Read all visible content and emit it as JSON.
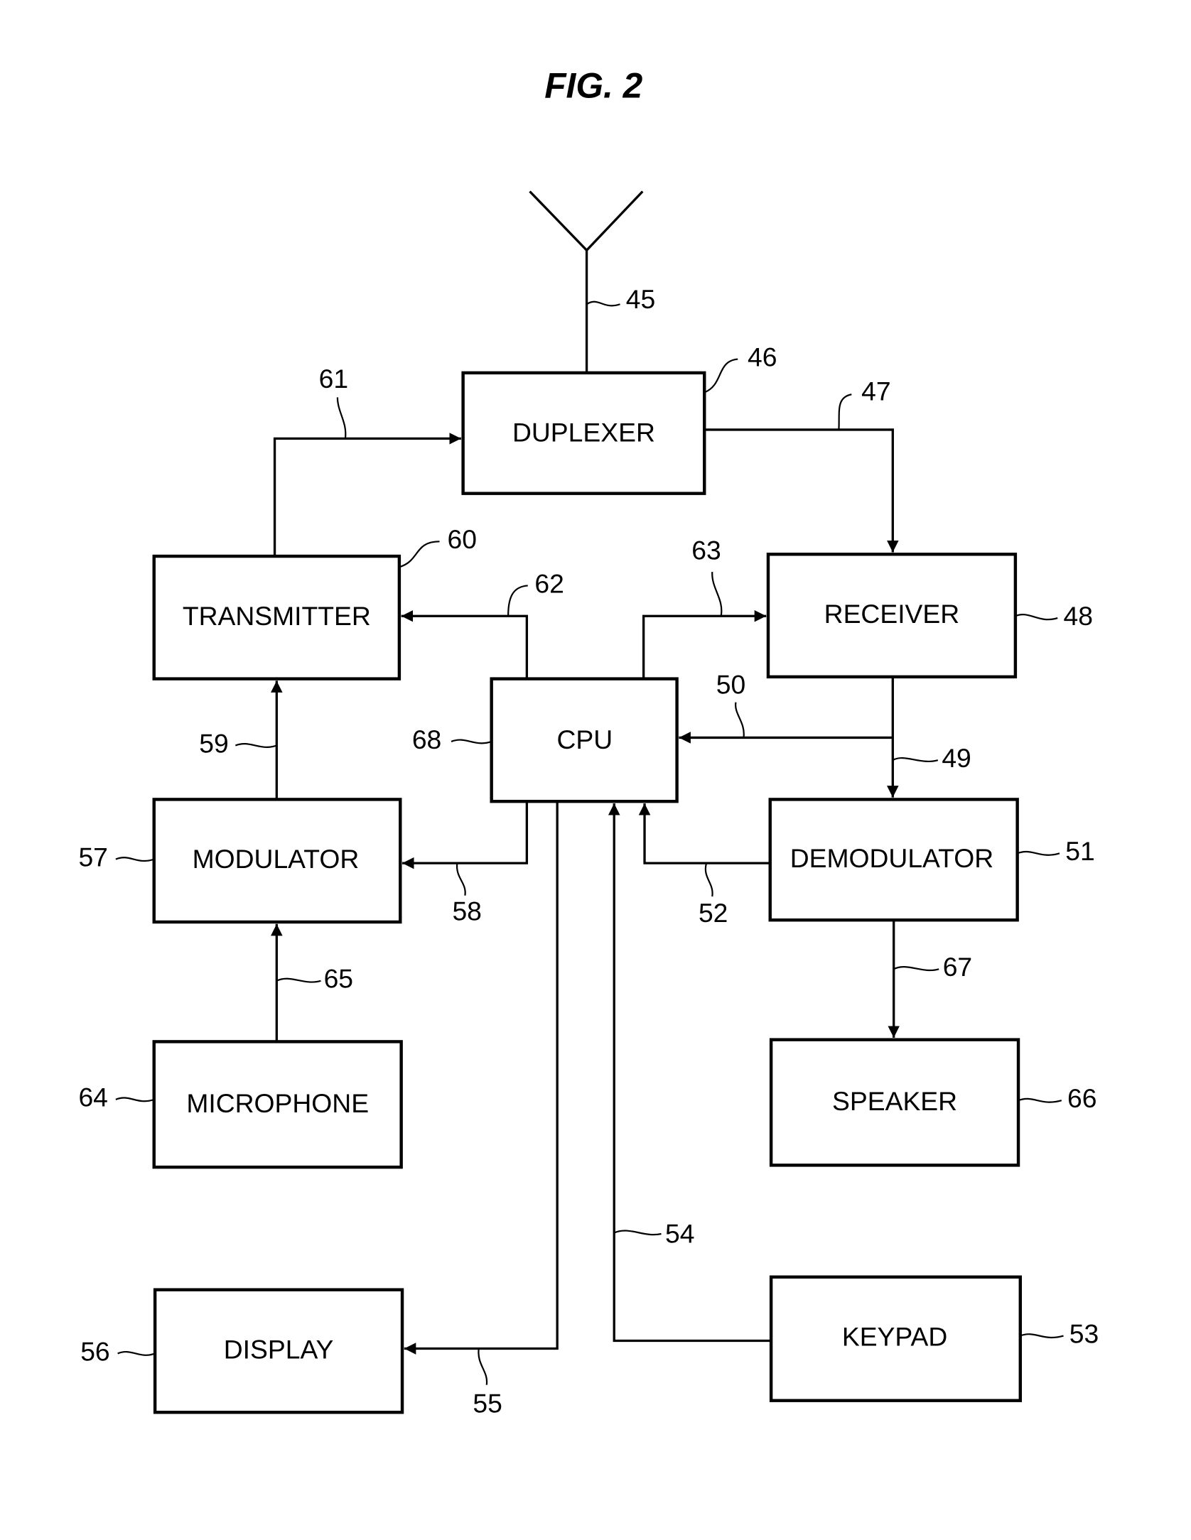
{
  "figure": {
    "title": "FIG. 2"
  },
  "blocks": {
    "duplexer": {
      "label": "DUPLEXER",
      "ref": "46"
    },
    "transmitter": {
      "label": "TRANSMITTER",
      "ref": "60"
    },
    "receiver": {
      "label": "RECEIVER",
      "ref": "48"
    },
    "cpu": {
      "label": "CPU",
      "ref": "68"
    },
    "modulator": {
      "label": "MODULATOR",
      "ref": "57"
    },
    "demodulator": {
      "label": "DEMODULATOR",
      "ref": "51"
    },
    "microphone": {
      "label": "MICROPHONE",
      "ref": "64"
    },
    "speaker": {
      "label": "SPEAKER",
      "ref": "66"
    },
    "display": {
      "label": "DISPLAY",
      "ref": "56"
    },
    "keypad": {
      "label": "KEYPAD",
      "ref": "53"
    }
  },
  "antenna": {
    "ref": "45"
  },
  "connections": {
    "duplexer_to_receiver": {
      "ref": "47",
      "from": "DUPLEXER",
      "to": "RECEIVER"
    },
    "transmitter_to_duplexer": {
      "ref": "61",
      "from": "TRANSMITTER",
      "to": "DUPLEXER"
    },
    "cpu_to_transmitter": {
      "ref": "62",
      "from": "CPU",
      "to": "TRANSMITTER"
    },
    "cpu_to_receiver": {
      "ref": "63",
      "from": "CPU",
      "to": "RECEIVER"
    },
    "receiver_to_cpu": {
      "ref": "50",
      "from": "RECEIVER",
      "to": "CPU"
    },
    "receiver_to_demodulator": {
      "ref": "49",
      "from": "RECEIVER",
      "to": "DEMODULATOR"
    },
    "demodulator_to_cpu": {
      "ref": "52",
      "from": "DEMODULATOR",
      "to": "CPU"
    },
    "cpu_to_modulator": {
      "ref": "58",
      "from": "CPU",
      "to": "MODULATOR"
    },
    "modulator_to_transmitter": {
      "ref": "59",
      "from": "MODULATOR",
      "to": "TRANSMITTER"
    },
    "microphone_to_modulator": {
      "ref": "65",
      "from": "MICROPHONE",
      "to": "MODULATOR"
    },
    "demodulator_to_speaker": {
      "ref": "67",
      "from": "DEMODULATOR",
      "to": "SPEAKER"
    },
    "cpu_to_display": {
      "ref": "55",
      "from": "CPU",
      "to": "DISPLAY"
    },
    "keypad_to_cpu": {
      "ref": "54",
      "from": "KEYPAD",
      "to": "CPU"
    }
  }
}
